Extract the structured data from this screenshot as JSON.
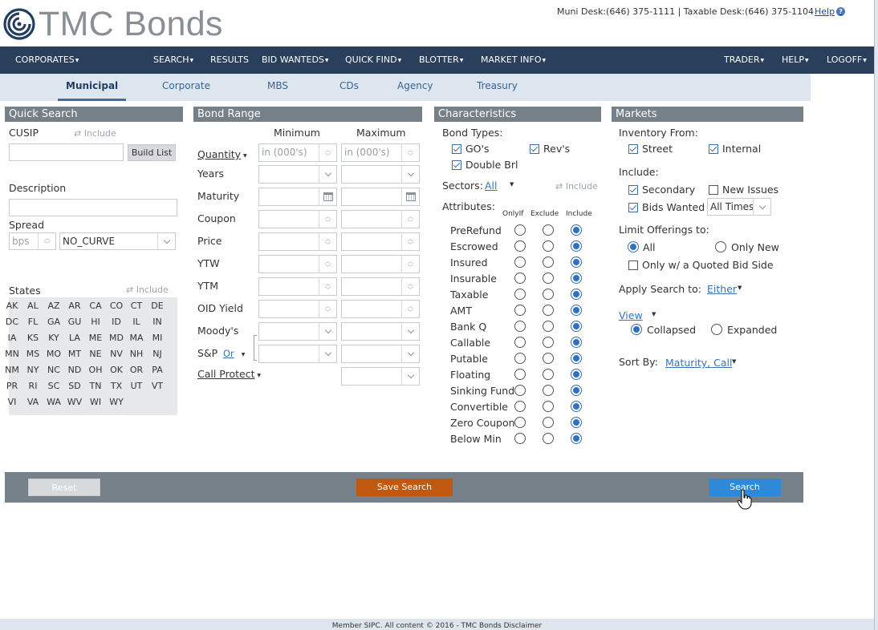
{
  "header": {
    "logo_text": "TMC Bonds",
    "desk_info": "Muni Desk:(646) 375-1111 | Taxable Desk:(646) 375-1104",
    "help_label": "Help"
  },
  "nav": {
    "left": [
      "CORPORATES",
      "SEARCH",
      "RESULTS",
      "BID WANTEDS",
      "QUICK FIND",
      "BLOTTER",
      "MARKET INFO"
    ],
    "right": [
      "TRADER",
      "HELP",
      "LOGOFF"
    ]
  },
  "subnav": {
    "tabs": [
      "Municipal",
      "Corporate",
      "MBS",
      "CDs",
      "Agency",
      "Treasury"
    ],
    "active": "Municipal"
  },
  "quick_search": {
    "title": "Quick Search",
    "cusip_label": "CUSIP",
    "include_label": "Include",
    "build_list_label": "Build List",
    "description_label": "Description",
    "spread_label": "Spread",
    "spread_unit": "bps",
    "curve_value": "NO_CURVE",
    "states_label": "States",
    "states": [
      "AK",
      "AL",
      "AZ",
      "AR",
      "CA",
      "CO",
      "CT",
      "DE",
      "DC",
      "FL",
      "GA",
      "GU",
      "HI",
      "ID",
      "IL",
      "IN",
      "IA",
      "KS",
      "KY",
      "LA",
      "ME",
      "MD",
      "MA",
      "MI",
      "MN",
      "MS",
      "MO",
      "MT",
      "NE",
      "NV",
      "NH",
      "NJ",
      "NM",
      "NY",
      "NC",
      "ND",
      "OH",
      "OK",
      "OR",
      "PA",
      "PR",
      "RI",
      "SC",
      "SD",
      "TN",
      "TX",
      "UT",
      "VT",
      "VI",
      "VA",
      "WA",
      "WV",
      "WI",
      "WY"
    ]
  },
  "bond_range": {
    "title": "Bond Range",
    "min_label": "Minimum",
    "max_label": "Maximum",
    "quantity_label": "Quantity",
    "quantity_placeholder": "in (000's)",
    "rows": [
      "Years",
      "Maturity",
      "Coupon",
      "Price",
      "YTW",
      "YTM",
      "OID Yield",
      "Moody's",
      "S&P"
    ],
    "or_label": "Or",
    "call_protect_label": "Call Protect"
  },
  "characteristics": {
    "title": "Characteristics",
    "bond_types_label": "Bond Types:",
    "bond_types": [
      "GO's",
      "Rev's",
      "Double Brl"
    ],
    "sectors_label": "Sectors:",
    "sectors_value": "All",
    "include_label": "Include",
    "attributes_label": "Attributes:",
    "col_headers": [
      "OnlyIf",
      "Exclude",
      "Include"
    ],
    "attributes": [
      "PreRefund",
      "Escrowed",
      "Insured",
      "Insurable",
      "Taxable",
      "AMT",
      "Bank Q",
      "Callable",
      "Putable",
      "Floating",
      "Sinking Fund",
      "Convertible",
      "Zero Coupon",
      "Below Min"
    ]
  },
  "markets": {
    "title": "Markets",
    "inventory_label": "Inventory From:",
    "street_label": "Street",
    "internal_label": "Internal",
    "include_label": "Include:",
    "secondary_label": "Secondary",
    "new_issues_label": "New Issues",
    "bids_wanted_label": "Bids Wanted",
    "bids_wanted_select": "All Times",
    "limit_label": "Limit Offerings to:",
    "all_label": "All",
    "only_new_label": "Only New",
    "quoted_bid_label": "Only w/ a Quoted Bid Side",
    "apply_label": "Apply Search to:",
    "apply_value": "Either",
    "view_label": "View",
    "collapsed_label": "Collapsed",
    "expanded_label": "Expanded",
    "sort_label": "Sort By:",
    "sort_value": "Maturity, Call"
  },
  "footer": {
    "reset_label": "Reset",
    "save_label": "Save Search",
    "search_label": "Search",
    "bottom_text": "Member SIPC. All content © 2016 - TMC Bonds  Disclaimer"
  },
  "colors": {
    "nav_bg": "#293f5c",
    "section_header": "#768089",
    "save_button": "#c0580f",
    "search_button": "#2e8ad8",
    "reset_button": "#d7d9dc"
  }
}
